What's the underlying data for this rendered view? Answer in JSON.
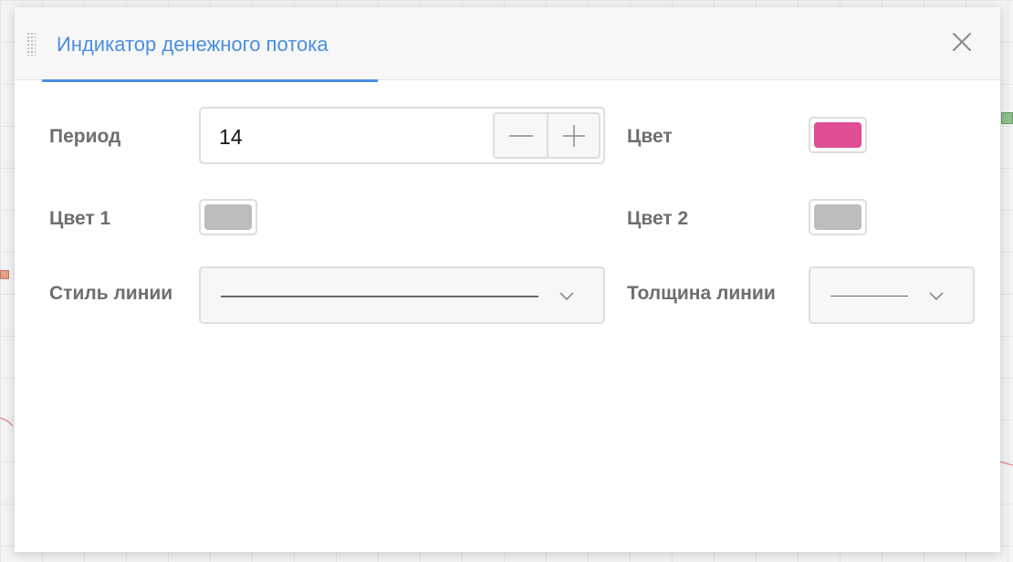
{
  "dialog": {
    "title": "Индикатор денежного потока",
    "close_icon": "close-icon"
  },
  "form": {
    "period": {
      "label": "Период",
      "value": "14"
    },
    "color": {
      "label": "Цвет",
      "value": "#e04f95"
    },
    "color1": {
      "label": "Цвет 1",
      "value": "#bdbdbd"
    },
    "color2": {
      "label": "Цвет 2",
      "value": "#bdbdbd"
    },
    "line_style": {
      "label": "Стиль линии",
      "selected": "solid"
    },
    "line_width": {
      "label": "Толщина линии",
      "selected": "thin"
    }
  },
  "colors": {
    "accent": "#4a8fdf",
    "label_text": "#6e6e6e",
    "border": "#dedede"
  }
}
